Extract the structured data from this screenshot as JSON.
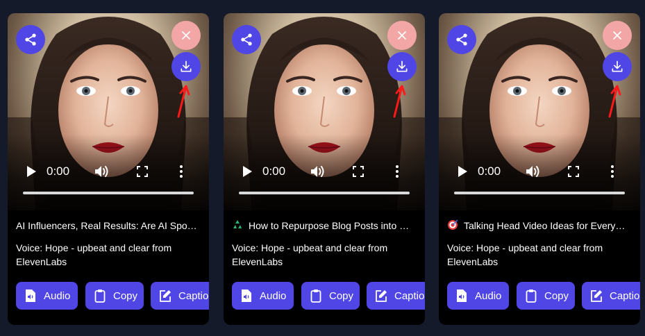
{
  "cards": [
    {
      "title": "AI Influencers, Real Results: Are AI Spo…",
      "title_icon": "",
      "voice": "Voice: Hope - upbeat and clear from ElevenLabs",
      "time": "0:00",
      "buttons": {
        "audio": "Audio",
        "copy": "Copy",
        "caption": "Caption"
      }
    },
    {
      "title": "How to Repurpose Blog Posts into …",
      "title_icon": "recycle-icon",
      "voice": "Voice: Hope - upbeat and clear from ElevenLabs",
      "time": "0:00",
      "buttons": {
        "audio": "Audio",
        "copy": "Copy",
        "caption": "Caption"
      }
    },
    {
      "title": "Talking Head Video Ideas for Every…",
      "title_icon": "target-icon",
      "voice": "Voice: Hope - upbeat and clear from ElevenLabs",
      "time": "0:00",
      "buttons": {
        "audio": "Audio",
        "copy": "Copy",
        "caption": "Caption"
      }
    }
  ],
  "colors": {
    "background": "#141a2a",
    "card": "#000000",
    "accent": "#4f46e5",
    "close": "#f3a6a6",
    "annotation_arrow": "#ff1a1a"
  }
}
